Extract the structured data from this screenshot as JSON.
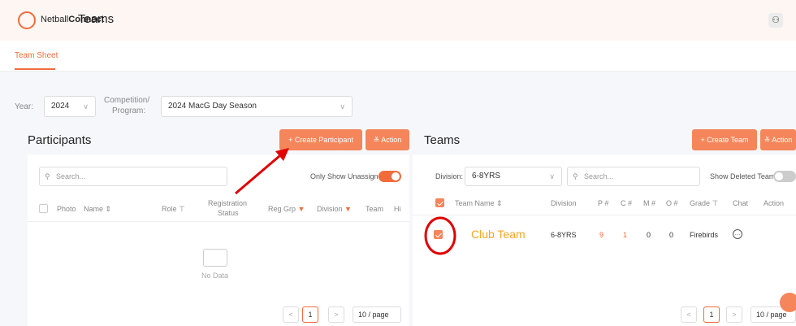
{
  "header": {
    "brand_prefix": "Netball",
    "brand_suffix": "Connect",
    "title": "Teams",
    "user_icon": "users-icon"
  },
  "subnav": {
    "tab": "Team Sheet"
  },
  "filters": {
    "year_label": "Year:",
    "year_value": "2024",
    "competition_label_1": "Competition/",
    "competition_label_2": "Program:",
    "competition_value": "2024 MacG Day Season"
  },
  "participants": {
    "title": "Participants",
    "create_label": "+ Create Participant",
    "action_label": "≚ Action",
    "search_placeholder": "Search...",
    "unassigned_label": "Only Show Unassigned",
    "columns": [
      "Photo",
      "Name ⇕",
      "Role ⊤",
      "Registration",
      "Status",
      "Reg Grp",
      "Division",
      "Team",
      "Hi"
    ],
    "no_data": "No Data",
    "page": "1",
    "page_size": "10 / page"
  },
  "teams": {
    "title": "Teams",
    "create_label": "+ Create Team",
    "action_label": "≚ Action",
    "division_label": "Division:",
    "division_value": "6-8YRS",
    "search_placeholder": "Search...",
    "deleted_label": "Show Deleted Teams",
    "columns": [
      "Team Name ⇕",
      "Division",
      "P #",
      "C #",
      "M #",
      "O #",
      "Grade ⊤",
      "Chat",
      "Action"
    ],
    "row": {
      "name": "Club Team",
      "division": "6-8YRS",
      "p": "9",
      "c": "1",
      "m": "0",
      "o": "0",
      "grade": "Firebirds"
    },
    "page": "1",
    "page_size": "10 / page"
  },
  "colors": {
    "accent": "#f26b3a",
    "annotation_red": "#e00000"
  }
}
